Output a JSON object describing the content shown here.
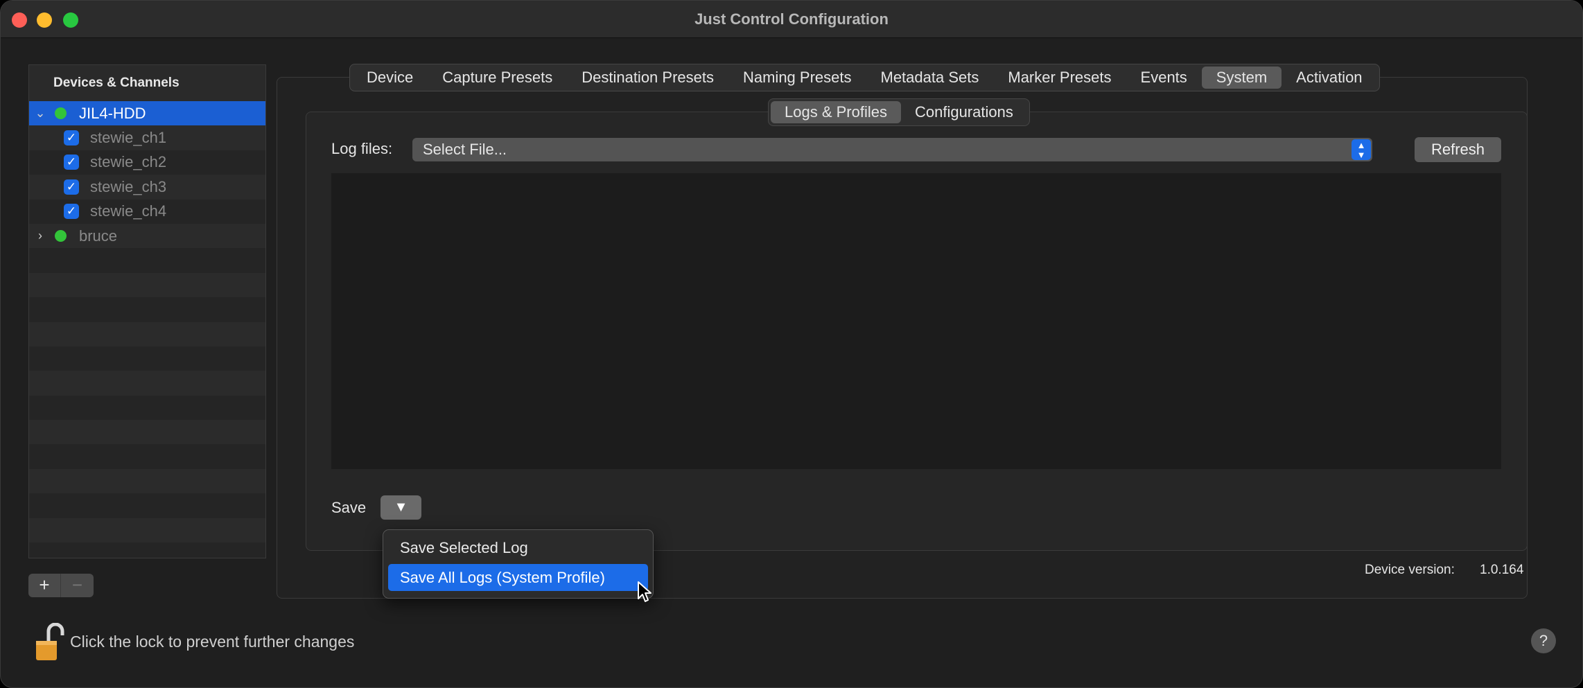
{
  "window": {
    "title": "Just Control Configuration"
  },
  "sidebar": {
    "header": "Devices & Channels",
    "devices": [
      {
        "label": "JIL4-HDD",
        "expanded": true,
        "selected": true,
        "status_color": "#33c43a",
        "channels": [
          {
            "label": "stewie_ch1",
            "checked": true
          },
          {
            "label": "stewie_ch2",
            "checked": true
          },
          {
            "label": "stewie_ch3",
            "checked": true
          },
          {
            "label": "stewie_ch4",
            "checked": true
          }
        ]
      },
      {
        "label": "bruce",
        "expanded": false,
        "selected": false,
        "status_color": "#33c43a"
      }
    ],
    "add_label": "+",
    "remove_label": "−"
  },
  "tabs": [
    {
      "label": "Device"
    },
    {
      "label": "Capture Presets"
    },
    {
      "label": "Destination Presets"
    },
    {
      "label": "Naming Presets"
    },
    {
      "label": "Metadata Sets"
    },
    {
      "label": "Marker Presets"
    },
    {
      "label": "Events"
    },
    {
      "label": "System",
      "active": true
    },
    {
      "label": "Activation"
    }
  ],
  "subtabs": [
    {
      "label": "Logs & Profiles",
      "active": true
    },
    {
      "label": "Configurations"
    }
  ],
  "logs": {
    "label": "Log files:",
    "select_value": "Select File...",
    "refresh_label": "Refresh",
    "save_label": "Save",
    "save_menu_glyph": "▼"
  },
  "save_menu": {
    "items": [
      {
        "label": "Save Selected Log"
      },
      {
        "label": "Save All Logs (System Profile)",
        "highlighted": true
      }
    ]
  },
  "version": {
    "label": "Device version:",
    "value": "1.0.164"
  },
  "footer": {
    "lock_text": "Click the lock to prevent further changes",
    "help_label": "?"
  },
  "colors": {
    "accent": "#1c6ce8",
    "selection": "#1b5fd3",
    "status_green": "#33c43a"
  }
}
